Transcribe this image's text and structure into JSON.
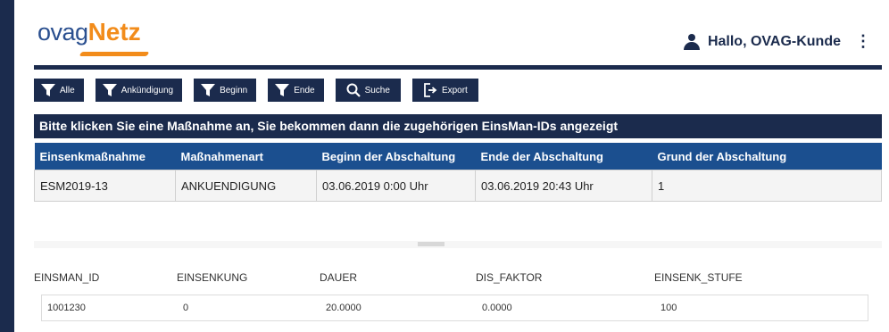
{
  "header": {
    "logo_ovag": "ovag",
    "logo_netz": "Netz",
    "user_greeting": "Hallo, OVAG-Kunde",
    "menu_glyph": "⋮"
  },
  "toolbar": {
    "buttons": [
      {
        "label": "Alle",
        "icon": "filter-icon"
      },
      {
        "label": "Ankündigung",
        "icon": "filter-icon"
      },
      {
        "label": "Beginn",
        "icon": "filter-icon"
      },
      {
        "label": "Ende",
        "icon": "filter-icon"
      },
      {
        "label": "Suche",
        "icon": "search-icon"
      },
      {
        "label": "Export",
        "icon": "export-icon"
      }
    ]
  },
  "banner": "Bitte klicken Sie eine Maßnahme an, Sie bekommen dann die zugehörigen EinsMan-IDs angezeigt",
  "measures_table": {
    "columns": [
      "Einsenkmaßnahme",
      "Maßnahmenart",
      "Beginn der Abschaltung",
      "Ende der Abschaltung",
      "Grund der Abschaltung"
    ],
    "rows": [
      [
        "ESM2019-13",
        "ANKUENDIGUNG",
        "03.06.2019 0:00 Uhr",
        "03.06.2019 20:43 Uhr",
        "1"
      ]
    ]
  },
  "ids_table": {
    "columns": [
      "EINSMAN_ID",
      "EINSENKUNG",
      "DAUER",
      "DIS_FAKTOR",
      "EINSENK_STUFE"
    ],
    "rows": [
      [
        "1001230",
        "0",
        "20.0000",
        "0.0000",
        "100"
      ]
    ]
  },
  "colors": {
    "primary": "#1b2b4d",
    "table_header": "#1b4f8f",
    "accent": "#f28c1b"
  }
}
